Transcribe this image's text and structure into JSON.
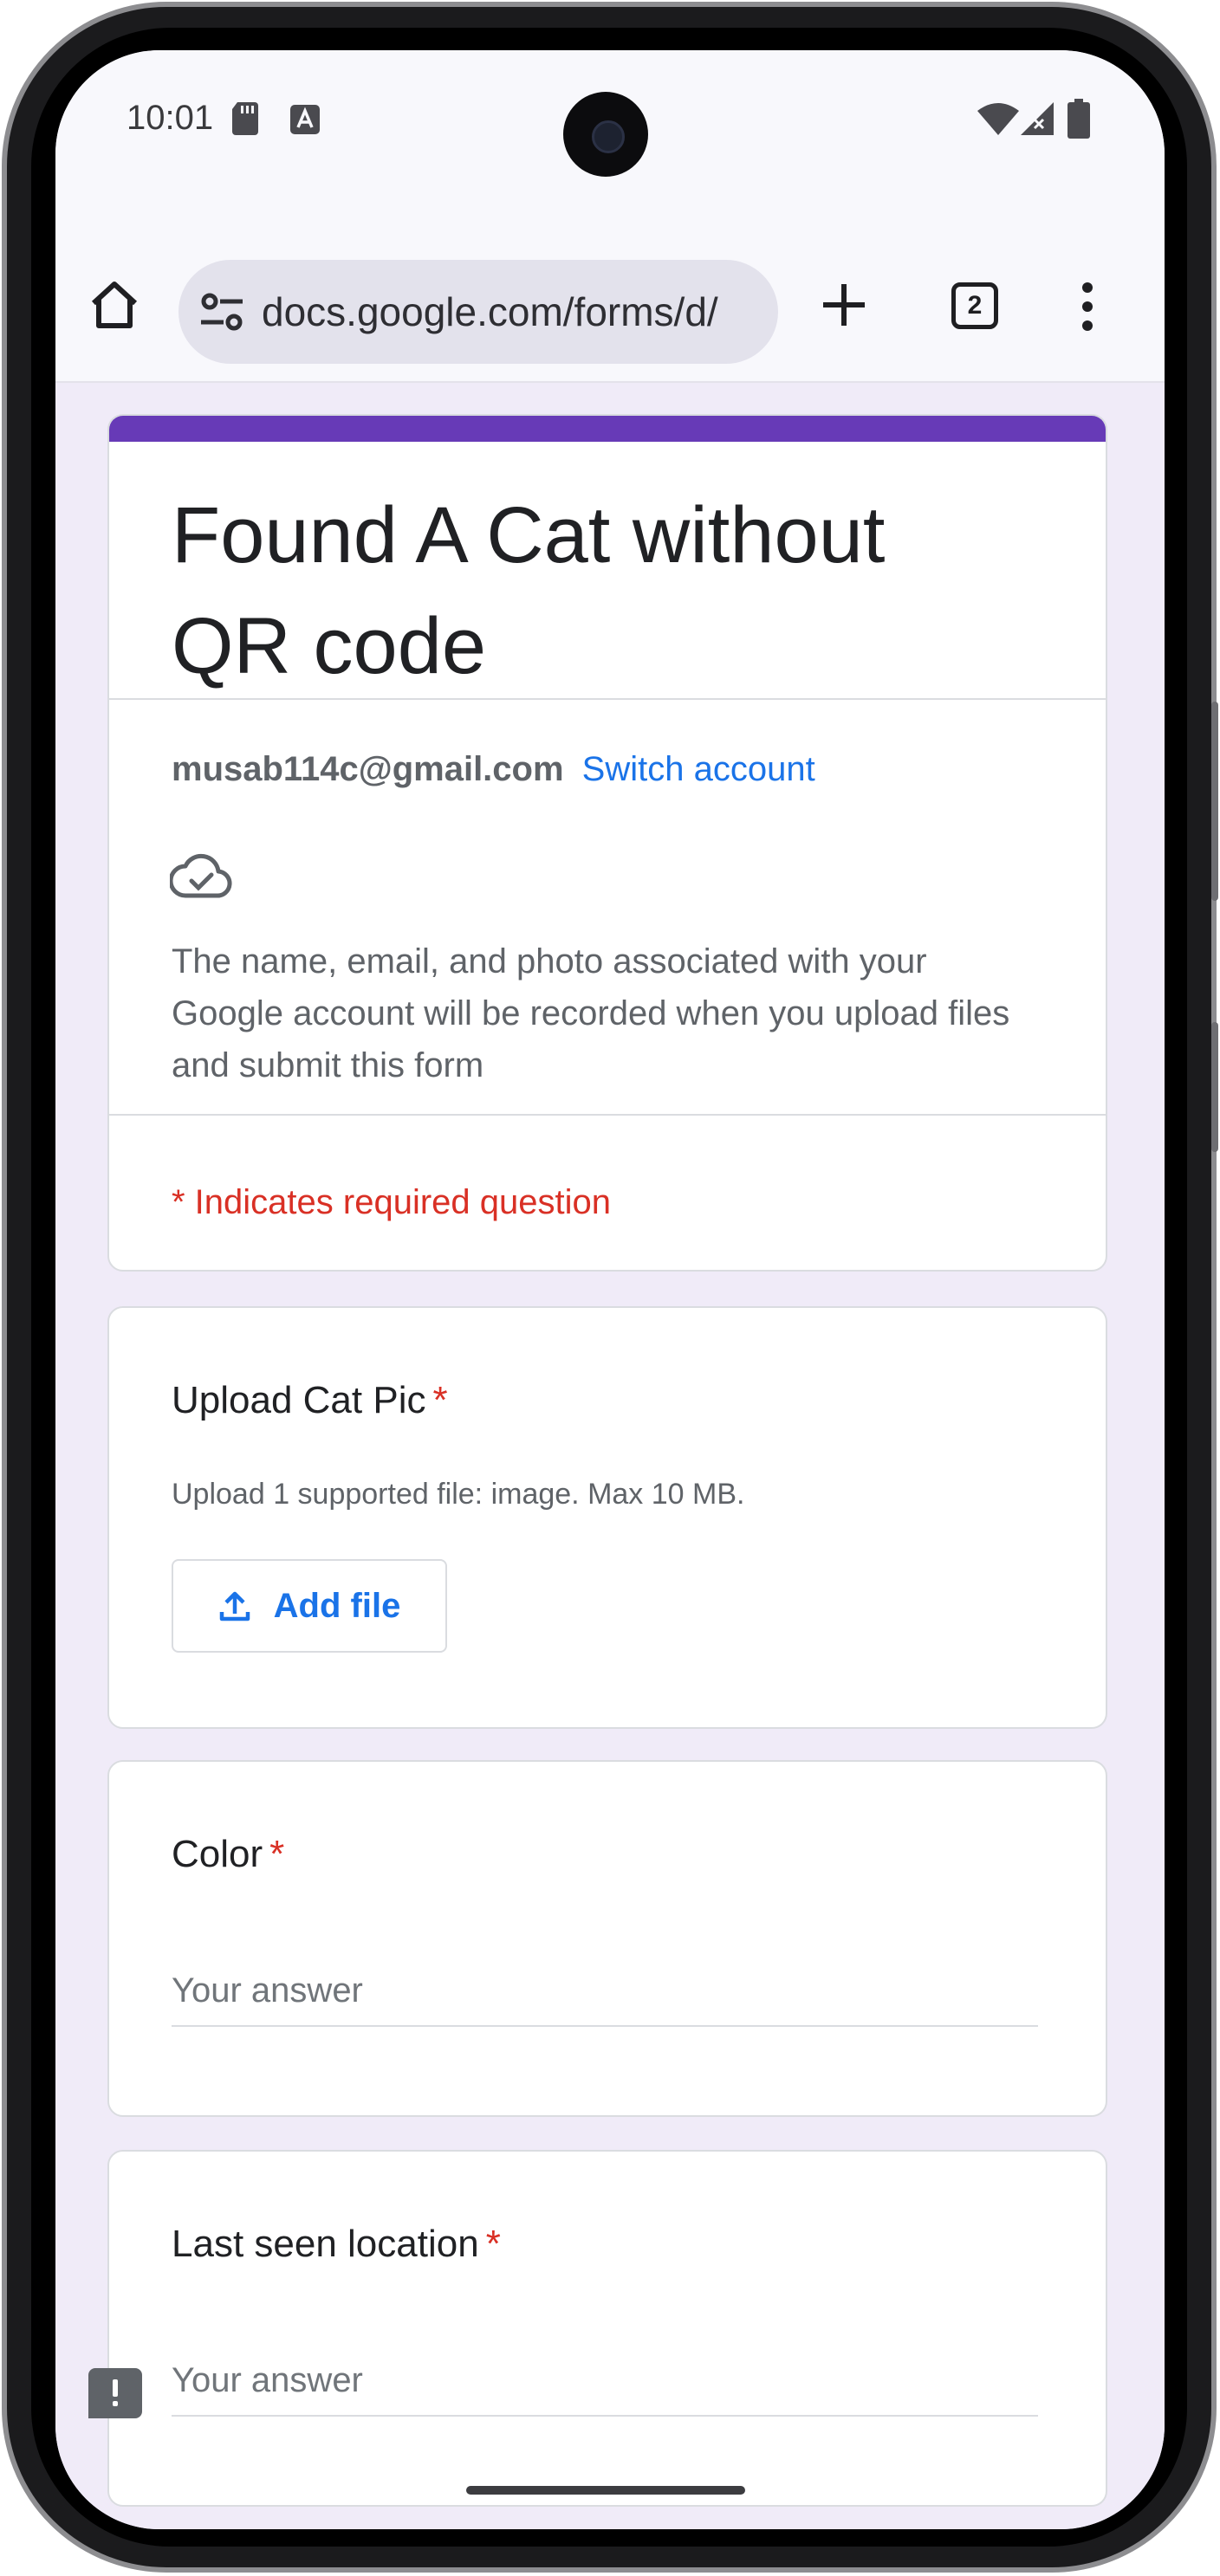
{
  "status_bar": {
    "time": "10:01",
    "icons_left": [
      "sd-card-icon",
      "a-badge-icon"
    ],
    "icons_right": [
      "wifi-icon",
      "signal-icon",
      "battery-icon"
    ]
  },
  "browser": {
    "url": "docs.google.com/forms/d/",
    "tab_count": "2"
  },
  "form": {
    "accent_color": "#673ab7",
    "title": "Found A Cat without QR code",
    "account_email": "musab114c@gmail.com",
    "switch_account": "Switch account",
    "notice": "The name, email, and photo associated with your Google account will be recorded when you upload files and submit this form",
    "required_note": "* Indicates required question",
    "questions": [
      {
        "title": "Upload Cat Pic",
        "required_mark": "*",
        "description": "Upload 1 supported file: image. Max 10 MB.",
        "button": "Add file"
      },
      {
        "title": "Color",
        "required_mark": "*",
        "placeholder": "Your answer"
      },
      {
        "title": "Last seen location",
        "required_mark": "*",
        "placeholder": "Your answer"
      }
    ]
  }
}
